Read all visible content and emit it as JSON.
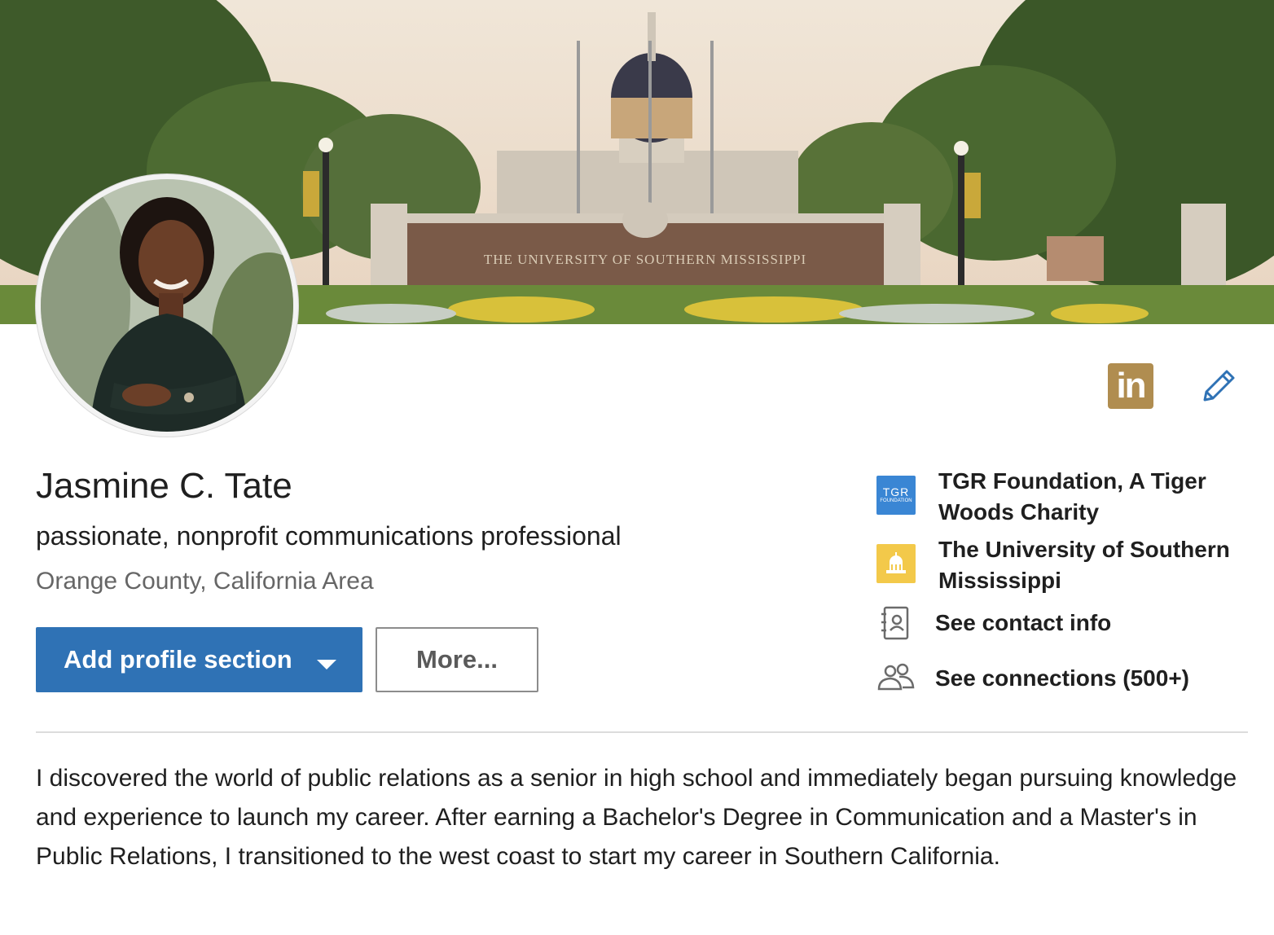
{
  "banner": {
    "sign_text": "THE UNIVERSITY OF SOUTHERN MISSISSIPPI"
  },
  "profile": {
    "name": "Jasmine C. Tate",
    "headline": "passionate, nonprofit communications professional",
    "location": "Orange County, California Area"
  },
  "actions": {
    "add_section_label": "Add profile section",
    "more_label": "More..."
  },
  "top_icons": {
    "linkedin_badge": "in"
  },
  "sidebar": {
    "current_position": "TGR Foundation, A Tiger Woods Charity",
    "tgr_logo_text": "TGR",
    "tgr_logo_sub": "FOUNDATION",
    "education": "The University of Southern Mississippi",
    "contact_info": "See contact info",
    "connections": "See connections (500+)"
  },
  "summary": {
    "text": "I discovered the world of public relations as a senior in high school and immediately began pursuing knowledge and experience to launch my career. After earning a Bachelor's Degree in Communication and a Master's in Public Relations, I transitioned to the west coast to start my career in Southern California."
  },
  "colors": {
    "primary_button": "#2f72b5",
    "linkedin_badge": "#b08d50",
    "tgr_logo": "#3a86d4",
    "usm_logo": "#f3c94a"
  }
}
